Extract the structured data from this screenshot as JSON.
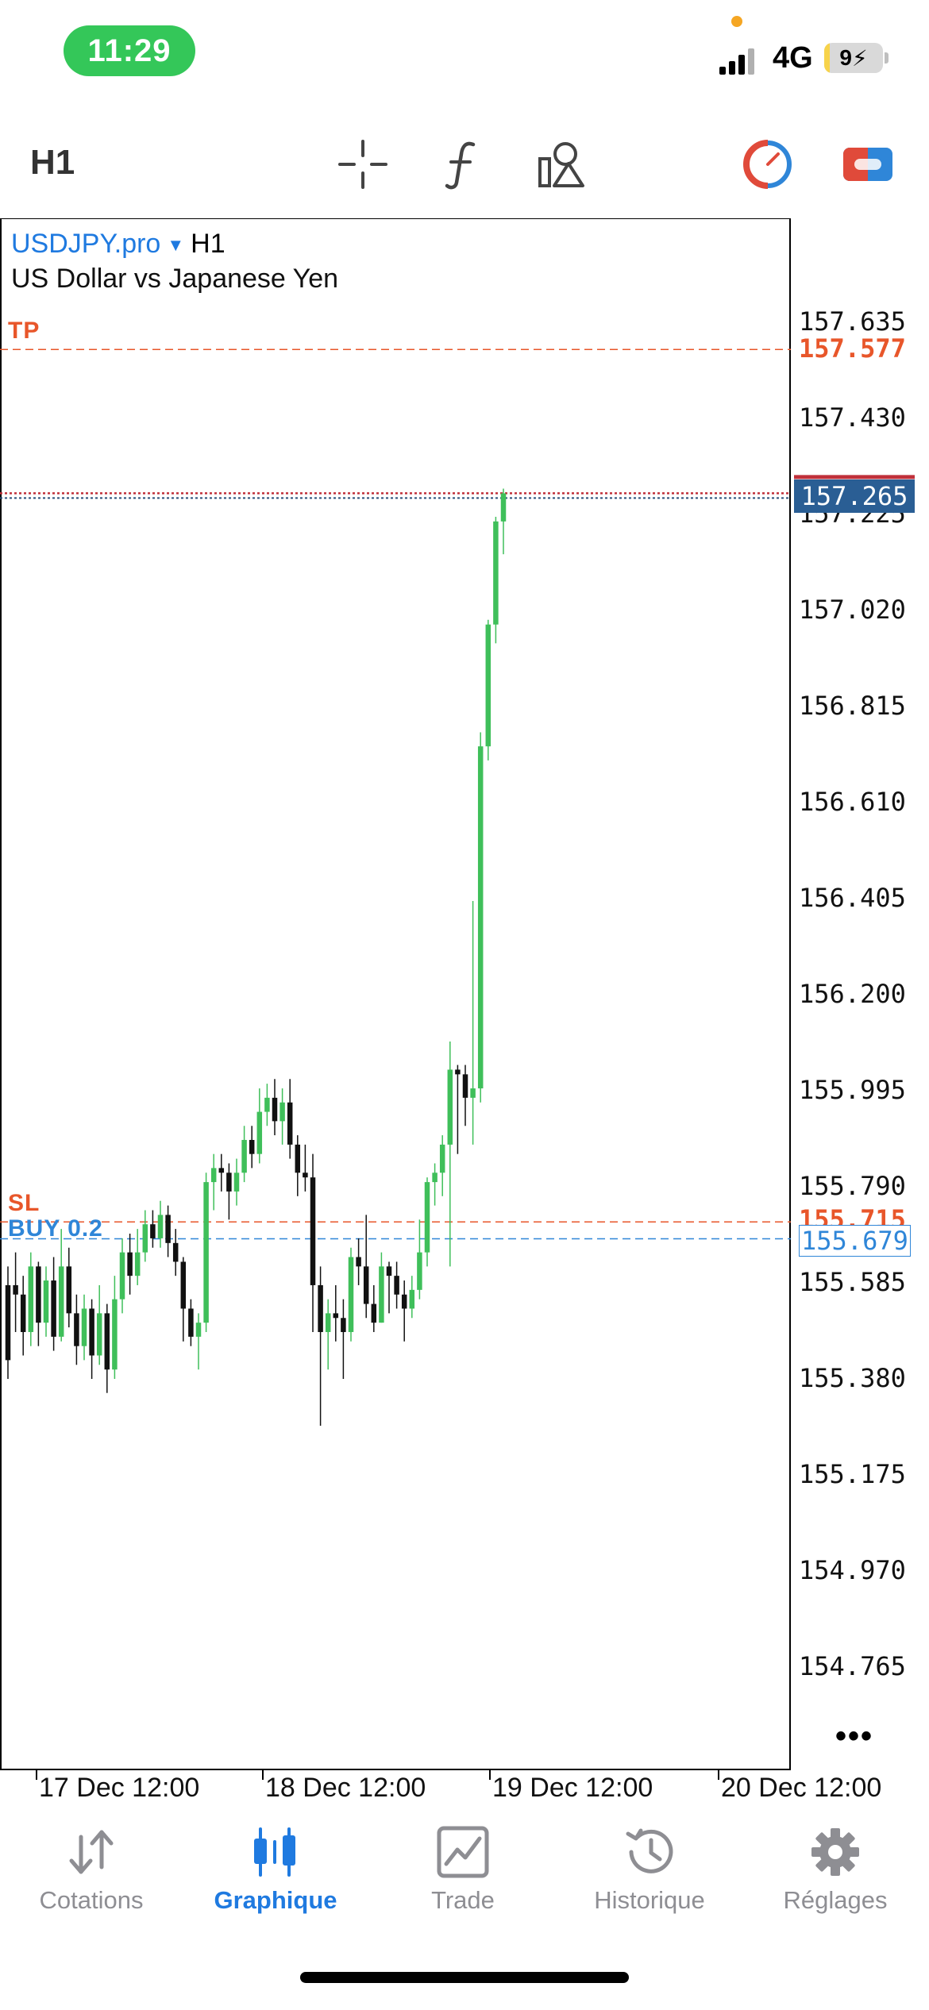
{
  "status_bar": {
    "time": "11:29",
    "network": "4G",
    "battery": "9",
    "battery_level": 0.09
  },
  "toolbar": {
    "timeframe": "H1",
    "icons": [
      "crosshair-icon",
      "indicators-icon",
      "objects-icon",
      "trade-gauge-icon",
      "one-click-trading-icon"
    ]
  },
  "chart": {
    "symbol": "USDJPY.pro",
    "timeframe": "H1",
    "description": "US Dollar vs Japanese Yen",
    "tp_label": "TP",
    "tp_price": "157.577",
    "sl_label": "SL",
    "sl_price": "155.715",
    "buy_label": "BUY 0.2",
    "buy_price": "155.679",
    "current_price": "157.265",
    "more": "•••",
    "colors": {
      "bull": "#3fbf5a",
      "bear": "#111111",
      "tp_sl": "#e8562a",
      "buy": "#2f86d8",
      "current": "#2a5e94",
      "ask": "#c0303a"
    }
  },
  "chart_data": {
    "type": "candlestick",
    "y_ticks": [
      "157.635",
      "157.430",
      "157.225",
      "157.020",
      "156.815",
      "156.610",
      "156.405",
      "156.200",
      "155.995",
      "155.790",
      "155.585",
      "155.380",
      "155.175",
      "154.970",
      "154.765"
    ],
    "x_ticks": [
      "17 Dec 12:00",
      "18 Dec 12:00",
      "19 Dec 12:00",
      "20 Dec 12:00"
    ],
    "ylim": [
      154.7,
      157.85
    ],
    "candles": [
      [
        155.58,
        155.42,
        155.62,
        155.38
      ],
      [
        155.58,
        155.56,
        155.65,
        155.48
      ],
      [
        155.56,
        155.48,
        155.6,
        155.43
      ],
      [
        155.48,
        155.62,
        155.65,
        155.45
      ],
      [
        155.62,
        155.5,
        155.63,
        155.45
      ],
      [
        155.5,
        155.59,
        155.62,
        155.47
      ],
      [
        155.59,
        155.47,
        155.64,
        155.44
      ],
      [
        155.47,
        155.62,
        155.7,
        155.46
      ],
      [
        155.62,
        155.52,
        155.66,
        155.49
      ],
      [
        155.52,
        155.45,
        155.56,
        155.41
      ],
      [
        155.45,
        155.53,
        155.56,
        155.42
      ],
      [
        155.53,
        155.43,
        155.55,
        155.38
      ],
      [
        155.43,
        155.52,
        155.58,
        155.41
      ],
      [
        155.52,
        155.4,
        155.54,
        155.35
      ],
      [
        155.4,
        155.55,
        155.6,
        155.38
      ],
      [
        155.55,
        155.65,
        155.68,
        155.52
      ],
      [
        155.65,
        155.6,
        155.69,
        155.56
      ],
      [
        155.6,
        155.65,
        155.7,
        155.58
      ],
      [
        155.65,
        155.71,
        155.74,
        155.63
      ],
      [
        155.71,
        155.68,
        155.74,
        155.66
      ],
      [
        155.68,
        155.73,
        155.76,
        155.66
      ],
      [
        155.73,
        155.67,
        155.75,
        155.64
      ],
      [
        155.67,
        155.63,
        155.7,
        155.6
      ],
      [
        155.63,
        155.53,
        155.64,
        155.46
      ],
      [
        155.53,
        155.47,
        155.55,
        155.45
      ],
      [
        155.47,
        155.5,
        155.52,
        155.4
      ],
      [
        155.5,
        155.8,
        155.82,
        155.48
      ],
      [
        155.8,
        155.83,
        155.86,
        155.74
      ],
      [
        155.83,
        155.82,
        155.86,
        155.78
      ],
      [
        155.82,
        155.78,
        155.84,
        155.72
      ],
      [
        155.78,
        155.82,
        155.85,
        155.75
      ],
      [
        155.82,
        155.89,
        155.92,
        155.8
      ],
      [
        155.89,
        155.86,
        155.92,
        155.83
      ],
      [
        155.86,
        155.95,
        156.0,
        155.84
      ],
      [
        155.95,
        155.98,
        156.01,
        155.92
      ],
      [
        155.98,
        155.93,
        156.02,
        155.9
      ],
      [
        155.93,
        155.97,
        156.0,
        155.88
      ],
      [
        155.97,
        155.88,
        156.02,
        155.85
      ],
      [
        155.88,
        155.82,
        155.9,
        155.77
      ],
      [
        155.82,
        155.81,
        155.88,
        155.78
      ],
      [
        155.81,
        155.58,
        155.86,
        155.48
      ],
      [
        155.58,
        155.48,
        155.62,
        155.28
      ],
      [
        155.48,
        155.52,
        155.55,
        155.4
      ],
      [
        155.52,
        155.51,
        155.58,
        155.46
      ],
      [
        155.51,
        155.48,
        155.55,
        155.38
      ],
      [
        155.48,
        155.64,
        155.66,
        155.46
      ],
      [
        155.64,
        155.62,
        155.68,
        155.58
      ],
      [
        155.62,
        155.54,
        155.73,
        155.51
      ],
      [
        155.54,
        155.5,
        155.58,
        155.48
      ],
      [
        155.5,
        155.62,
        155.65,
        155.5
      ],
      [
        155.62,
        155.6,
        155.63,
        155.52
      ],
      [
        155.6,
        155.56,
        155.63,
        155.53
      ],
      [
        155.56,
        155.53,
        155.59,
        155.46
      ],
      [
        155.53,
        155.57,
        155.6,
        155.51
      ],
      [
        155.57,
        155.65,
        155.72,
        155.55
      ],
      [
        155.65,
        155.8,
        155.81,
        155.62
      ],
      [
        155.8,
        155.82,
        155.84,
        155.75
      ],
      [
        155.82,
        155.88,
        155.9,
        155.77
      ],
      [
        155.88,
        156.04,
        156.1,
        155.62
      ],
      [
        156.04,
        156.03,
        156.05,
        155.86
      ],
      [
        156.03,
        155.98,
        156.05,
        155.92
      ],
      [
        155.98,
        156.0,
        156.4,
        155.88
      ],
      [
        156.0,
        156.73,
        156.76,
        155.97
      ],
      [
        156.73,
        156.99,
        157.0,
        156.7
      ],
      [
        156.99,
        157.21,
        157.22,
        156.95
      ],
      [
        157.21,
        157.27,
        157.28,
        157.14
      ]
    ]
  },
  "bottom_nav": {
    "items": [
      {
        "label": "Cotations",
        "icon": "quotes-arrows-icon",
        "active": false
      },
      {
        "label": "Graphique",
        "icon": "chart-candles-icon",
        "active": true
      },
      {
        "label": "Trade",
        "icon": "trade-chart-icon",
        "active": false
      },
      {
        "label": "Historique",
        "icon": "history-icon",
        "active": false
      },
      {
        "label": "Réglages",
        "icon": "settings-gear-icon",
        "active": false
      }
    ]
  }
}
